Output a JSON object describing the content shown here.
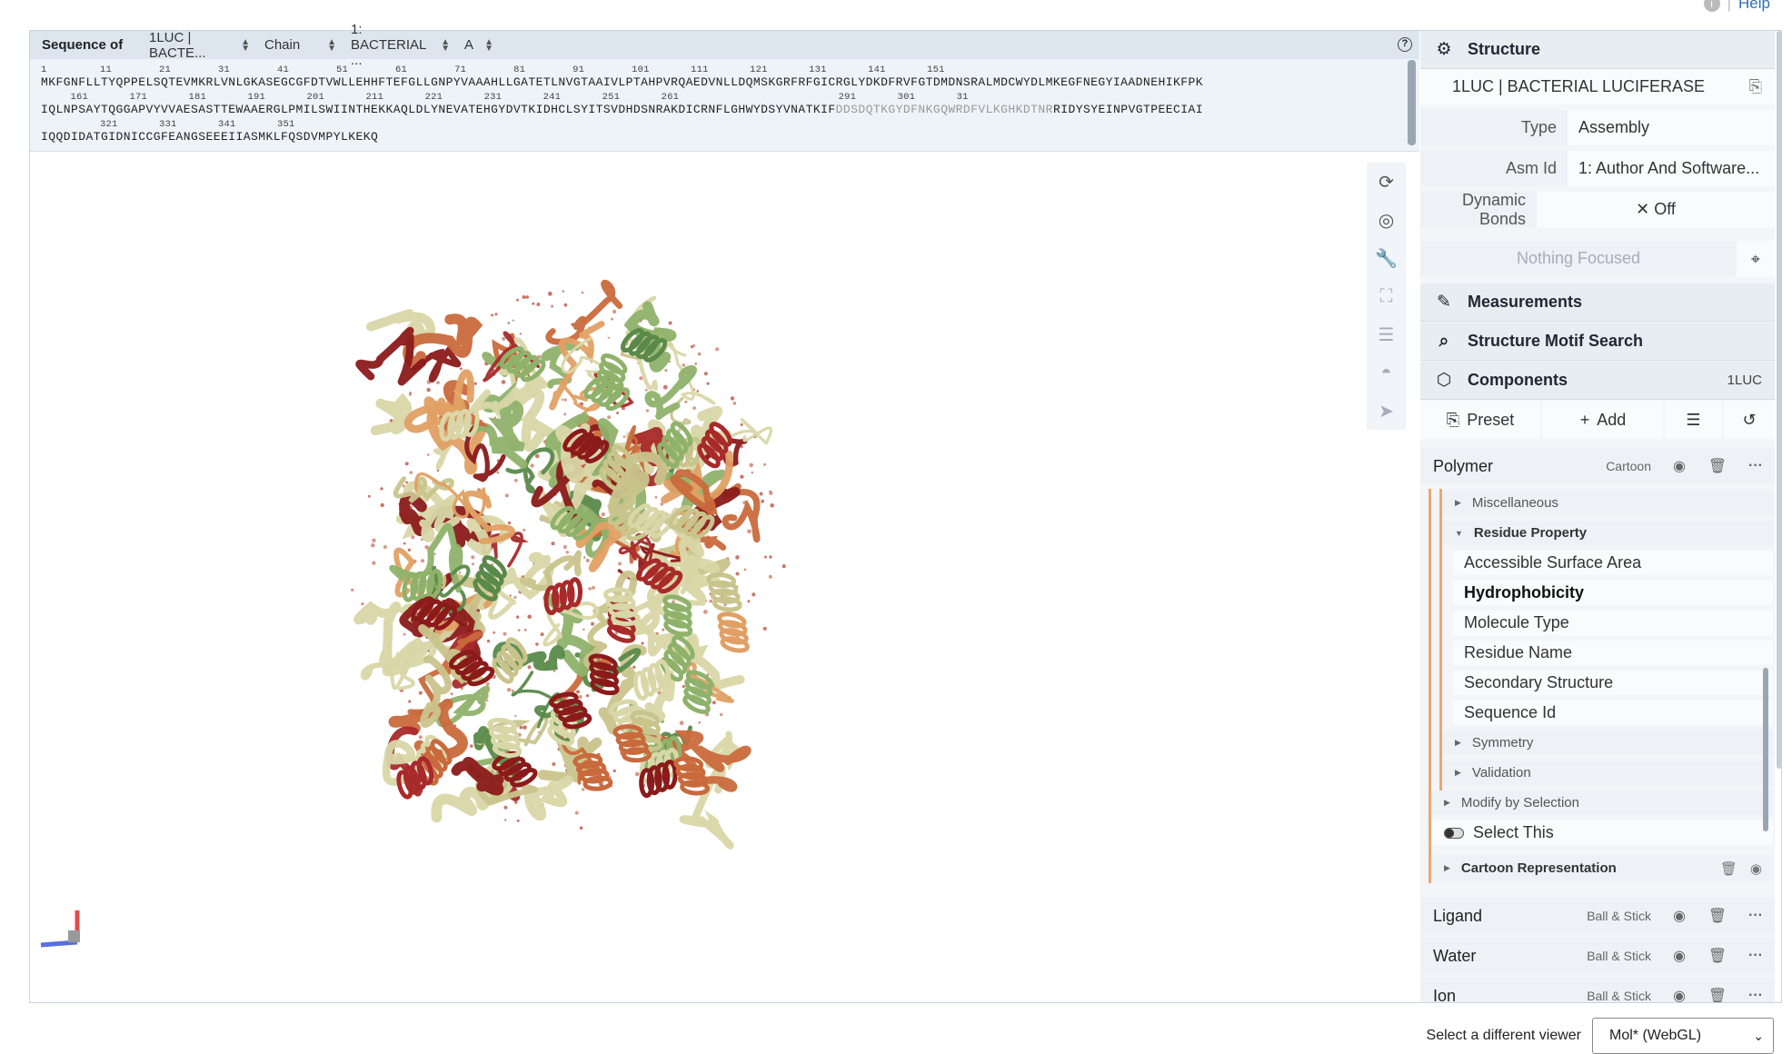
{
  "top_links": {
    "help": "Help"
  },
  "sequence": {
    "label": "Sequence of",
    "entity_select": "1LUC | BACTE...",
    "chain_mode_select": "Chain",
    "chain_select": "1: BACTERIAL ...",
    "instance_select": "A",
    "rows": [
      {
        "nums": "1         11        21        31        41        51        61        71        81        91        101       111       121       131       141       151",
        "text": "MKFGNFLLTYQPPELSQTEVMKRLVNLGKASEGCGFDTVWLLEHHFTEFGLLGNPYVAAAHLLGATETLNVGTAAIVLPTAHPVRQAEDVNLLDQMSKGRFRFGICRGLYDKDFRVFGTDMDNSRALMDCWYDLMKEGFNEGYIAADNEHIKFPK",
        "dim": ""
      },
      {
        "nums": "     161       171       181       191       201       211       221       231       241       251       261                           291       301       31",
        "text": "IQLNPSAYTQGGAPVYVVAESASTTEWAAERGLPMILSWIINTHEKKAQLDLYNEVATEHGYDVTKIDHCLSYITSVDHDSNRAKDICRNFLGHWYDSYVNATKIF",
        "dim": "DDSDQTKGYDFNKGQWRDFVLKGHKDTNR",
        "text2": "RIDYSYEINPVGTPEECIAI"
      },
      {
        "nums": "          321       331       341       351",
        "text": "IQQDIDATGIDNICCGFEANGSEEEIIASMKLFQSDVMPYLKEKQ",
        "dim": ""
      }
    ]
  },
  "viewport_tools": [
    "reset-camera-icon",
    "screenshot-icon",
    "wrench-icon",
    "expand-icon",
    "sliders-icon",
    "vr-icon",
    "pointer-icon"
  ],
  "right_panel": {
    "structure": {
      "title": "Structure",
      "entry": "1LUC | BACTERIAL LUCIFERASE",
      "type_label": "Type",
      "type_value": "Assembly",
      "asm_label": "Asm Id",
      "asm_value": "1: Author And Software...",
      "dynamic_label": "Dynamic Bonds",
      "dynamic_value": "Off",
      "focus_text": "Nothing Focused"
    },
    "measurements": "Measurements",
    "motif_search": "Structure Motif Search",
    "components": {
      "title": "Components",
      "id": "1LUC",
      "preset": "Preset",
      "add": "Add"
    },
    "polymer": {
      "name": "Polymer",
      "type": "Cartoon"
    },
    "tree": {
      "misc": "Miscellaneous",
      "residue_property": "Residue Property",
      "options": [
        "Accessible Surface Area",
        "Hydrophobicity",
        "Molecule Type",
        "Residue Name",
        "Secondary Structure",
        "Sequence Id"
      ],
      "selected_option": "Hydrophobicity",
      "symmetry": "Symmetry",
      "validation": "Validation",
      "modify": "Modify by Selection",
      "select_this": "Select This",
      "cartoon_rep": "Cartoon Representation"
    },
    "other_components": [
      {
        "name": "Ligand",
        "type": "Ball & Stick"
      },
      {
        "name": "Water",
        "type": "Ball & Stick"
      },
      {
        "name": "Ion",
        "type": "Ball & Stick"
      }
    ]
  },
  "bottom": {
    "label": "Select a different viewer",
    "viewer": "Mol* (WebGL)"
  },
  "colors": {
    "accent": "#2f6fb5",
    "tree_line": "#e7a873",
    "dark_red": "#8b1a1a",
    "pale_green": "#d9d7a8",
    "green": "#5a8a4a",
    "orange": "#c96a3c"
  }
}
